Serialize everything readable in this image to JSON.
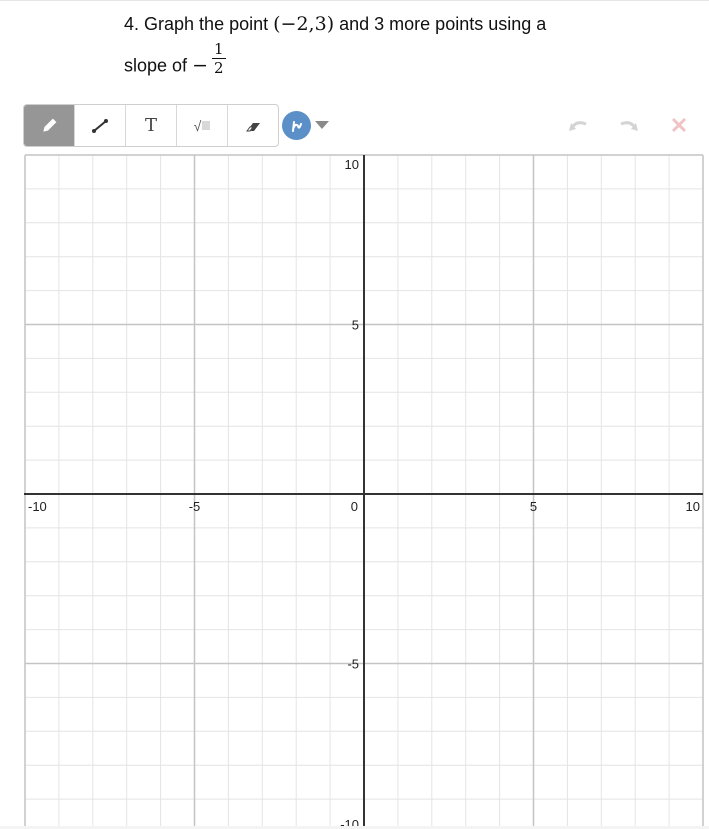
{
  "question": {
    "number": "4.",
    "text_before": "Graph the point",
    "point": "(−2,3)",
    "text_after": "and 3 more points using a",
    "line2_text": "slope of",
    "slope_sign": "−",
    "slope_numerator": "1",
    "slope_denominator": "2"
  },
  "toolbar": {
    "tools": [
      {
        "name": "pencil",
        "icon": "pencil-icon",
        "active": true
      },
      {
        "name": "line",
        "icon": "line-segment-icon",
        "active": false
      },
      {
        "name": "text",
        "icon": "text-icon",
        "label": "T",
        "active": false
      },
      {
        "name": "math",
        "icon": "square-root-icon",
        "label": "√",
        "active": false
      },
      {
        "name": "eraser",
        "icon": "eraser-icon",
        "active": false
      }
    ],
    "color": {
      "icon": "stroke-color-icon",
      "value": "#5b8fc7"
    },
    "actions": [
      {
        "name": "undo",
        "icon": "undo-icon",
        "enabled": false
      },
      {
        "name": "redo",
        "icon": "redo-icon",
        "enabled": false
      },
      {
        "name": "clear",
        "icon": "close-icon",
        "enabled": false
      }
    ]
  },
  "graph": {
    "x_range": [
      -10,
      10
    ],
    "y_range": [
      -10,
      10
    ],
    "grid_step": 1,
    "major_step": 5,
    "x_tick_labels": [
      "-10",
      "-5",
      "0",
      "5",
      "10"
    ],
    "y_tick_labels": [
      "10",
      "5",
      "-5",
      "-10"
    ],
    "x_tick_values": [
      -10,
      -5,
      0,
      5,
      10
    ],
    "y_tick_values": [
      10,
      5,
      -5,
      -10
    ]
  }
}
